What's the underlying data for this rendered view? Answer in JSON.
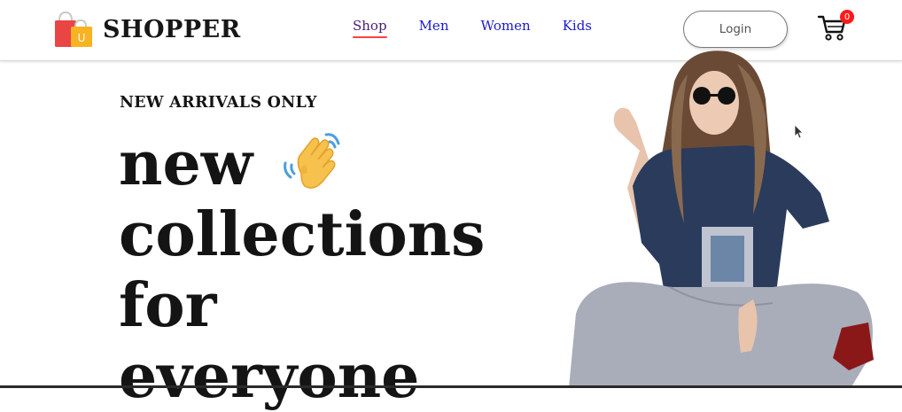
{
  "brand": {
    "name": "SHOPPER",
    "logo_badge": "U",
    "logo_icon": "shopping-bag-logo-icon"
  },
  "nav": {
    "items": [
      {
        "label": "Shop",
        "active": true
      },
      {
        "label": "Men",
        "active": false
      },
      {
        "label": "Women",
        "active": false
      },
      {
        "label": "Kids",
        "active": false
      }
    ]
  },
  "header": {
    "login_label": "Login",
    "cart_icon": "cart-icon",
    "cart_count": "0"
  },
  "hero": {
    "label": "NEW ARRIVALS ONLY",
    "title_lines": [
      "new",
      "collections",
      "for",
      "everyone"
    ],
    "wave_icon": "waving-hand-icon",
    "image_icon": "hero-model-image"
  },
  "colors": {
    "accent": "#ff4141",
    "nav_link": "#1a1acc",
    "nav_active": "#4a1a7a",
    "text_dark": "#141414",
    "badge": "#ff1a1a"
  }
}
